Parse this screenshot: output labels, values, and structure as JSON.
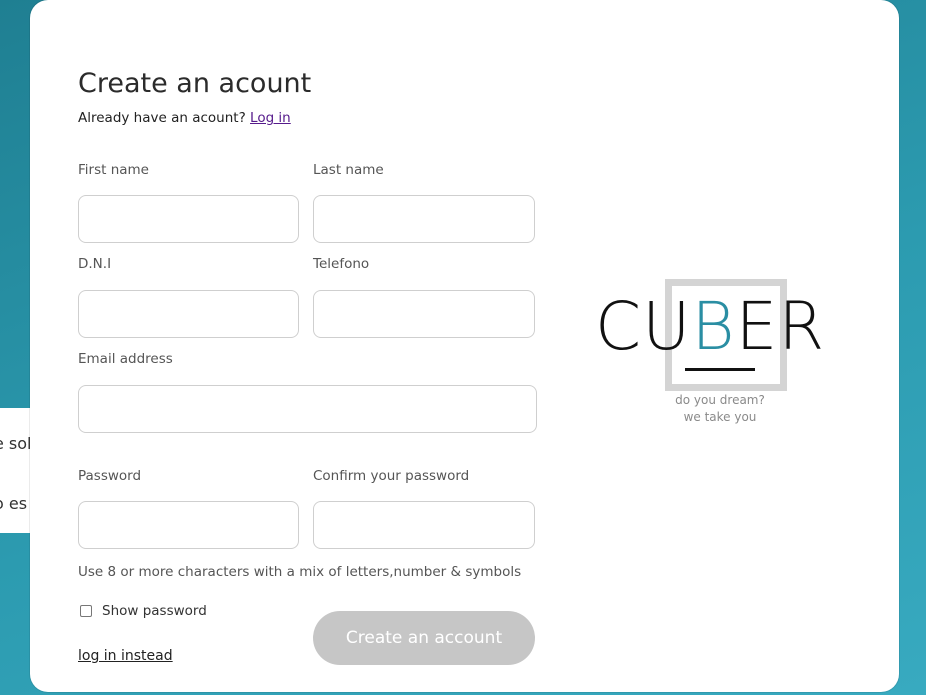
{
  "background_panel": {
    "line1": "e sol",
    "line2": "o es"
  },
  "form": {
    "title": "Create an acount",
    "subtitle_text": "Already have an acount?",
    "subtitle_link": "Log in",
    "first_name_label": "First name",
    "last_name_label": "Last name",
    "dni_label": "D.N.I",
    "phone_label": "Telefono",
    "email_label": "Email address",
    "password_label": "Password",
    "confirm_password_label": "Confirm your password",
    "password_hint": "Use 8 or more characters with a mix of letters,number & symbols",
    "show_password_label": "Show password",
    "show_password_checked": false,
    "create_button_label": "Create an account",
    "login_instead_label": "log in instead"
  },
  "logo": {
    "word_prefix": "CU",
    "word_highlight": "B",
    "word_suffix": "ER",
    "tagline_1": "do you dream?",
    "tagline_2": "we take you"
  },
  "colors": {
    "background": "#2a95aa",
    "logo_accent": "#2a8ea3",
    "button_disabled": "#c6c6c6"
  }
}
